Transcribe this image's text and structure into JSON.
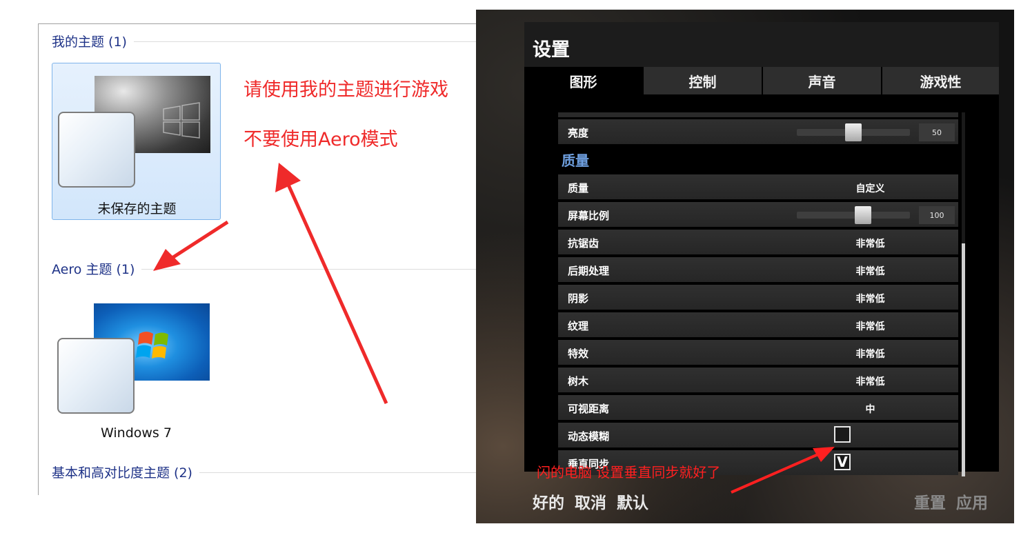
{
  "themes": {
    "my_themes_header": "我的主题 (1)",
    "aero_header": "Aero 主题 (1)",
    "basic_header": "基本和高对比度主题 (2)",
    "unsaved_theme_label": "未保存的主题",
    "windows7_label": "Windows 7"
  },
  "notes": {
    "use_my_theme": "请使用我的主题进行游戏",
    "no_aero": "不要使用Aero模式",
    "vsync_tip": "闪的电脑 设置垂直同步就好了"
  },
  "dialog": {
    "title": "设置",
    "tabs": [
      "图形",
      "控制",
      "声音",
      "游戏性"
    ],
    "brightness": {
      "label": "亮度",
      "value": "50",
      "fraction": 0.5
    },
    "quality_section": "质量",
    "quality": {
      "label": "质量",
      "value": "自定义"
    },
    "screen_ratio": {
      "label": "屏幕比例",
      "value": "100",
      "fraction": 0.6
    },
    "antialias": {
      "label": "抗锯齿",
      "value": "非常低"
    },
    "postprocess": {
      "label": "后期处理",
      "value": "非常低"
    },
    "shadow": {
      "label": "阴影",
      "value": "非常低"
    },
    "texture": {
      "label": "纹理",
      "value": "非常低"
    },
    "effects": {
      "label": "特效",
      "value": "非常低"
    },
    "trees": {
      "label": "树木",
      "value": "非常低"
    },
    "view_distance": {
      "label": "可视距离",
      "value": "中"
    },
    "motion_blur": {
      "label": "动态模糊",
      "checked": false
    },
    "vsync": {
      "label": "垂直同步",
      "checked": true,
      "mark": "V"
    },
    "footer": {
      "ok": "好的",
      "cancel": "取消",
      "default": "默认",
      "reset": "重置",
      "apply": "应用"
    }
  },
  "colors": {
    "note_red": "#ef2a2a",
    "section_blue": "#6fa0e0",
    "group_header_blue": "#1e3287"
  }
}
